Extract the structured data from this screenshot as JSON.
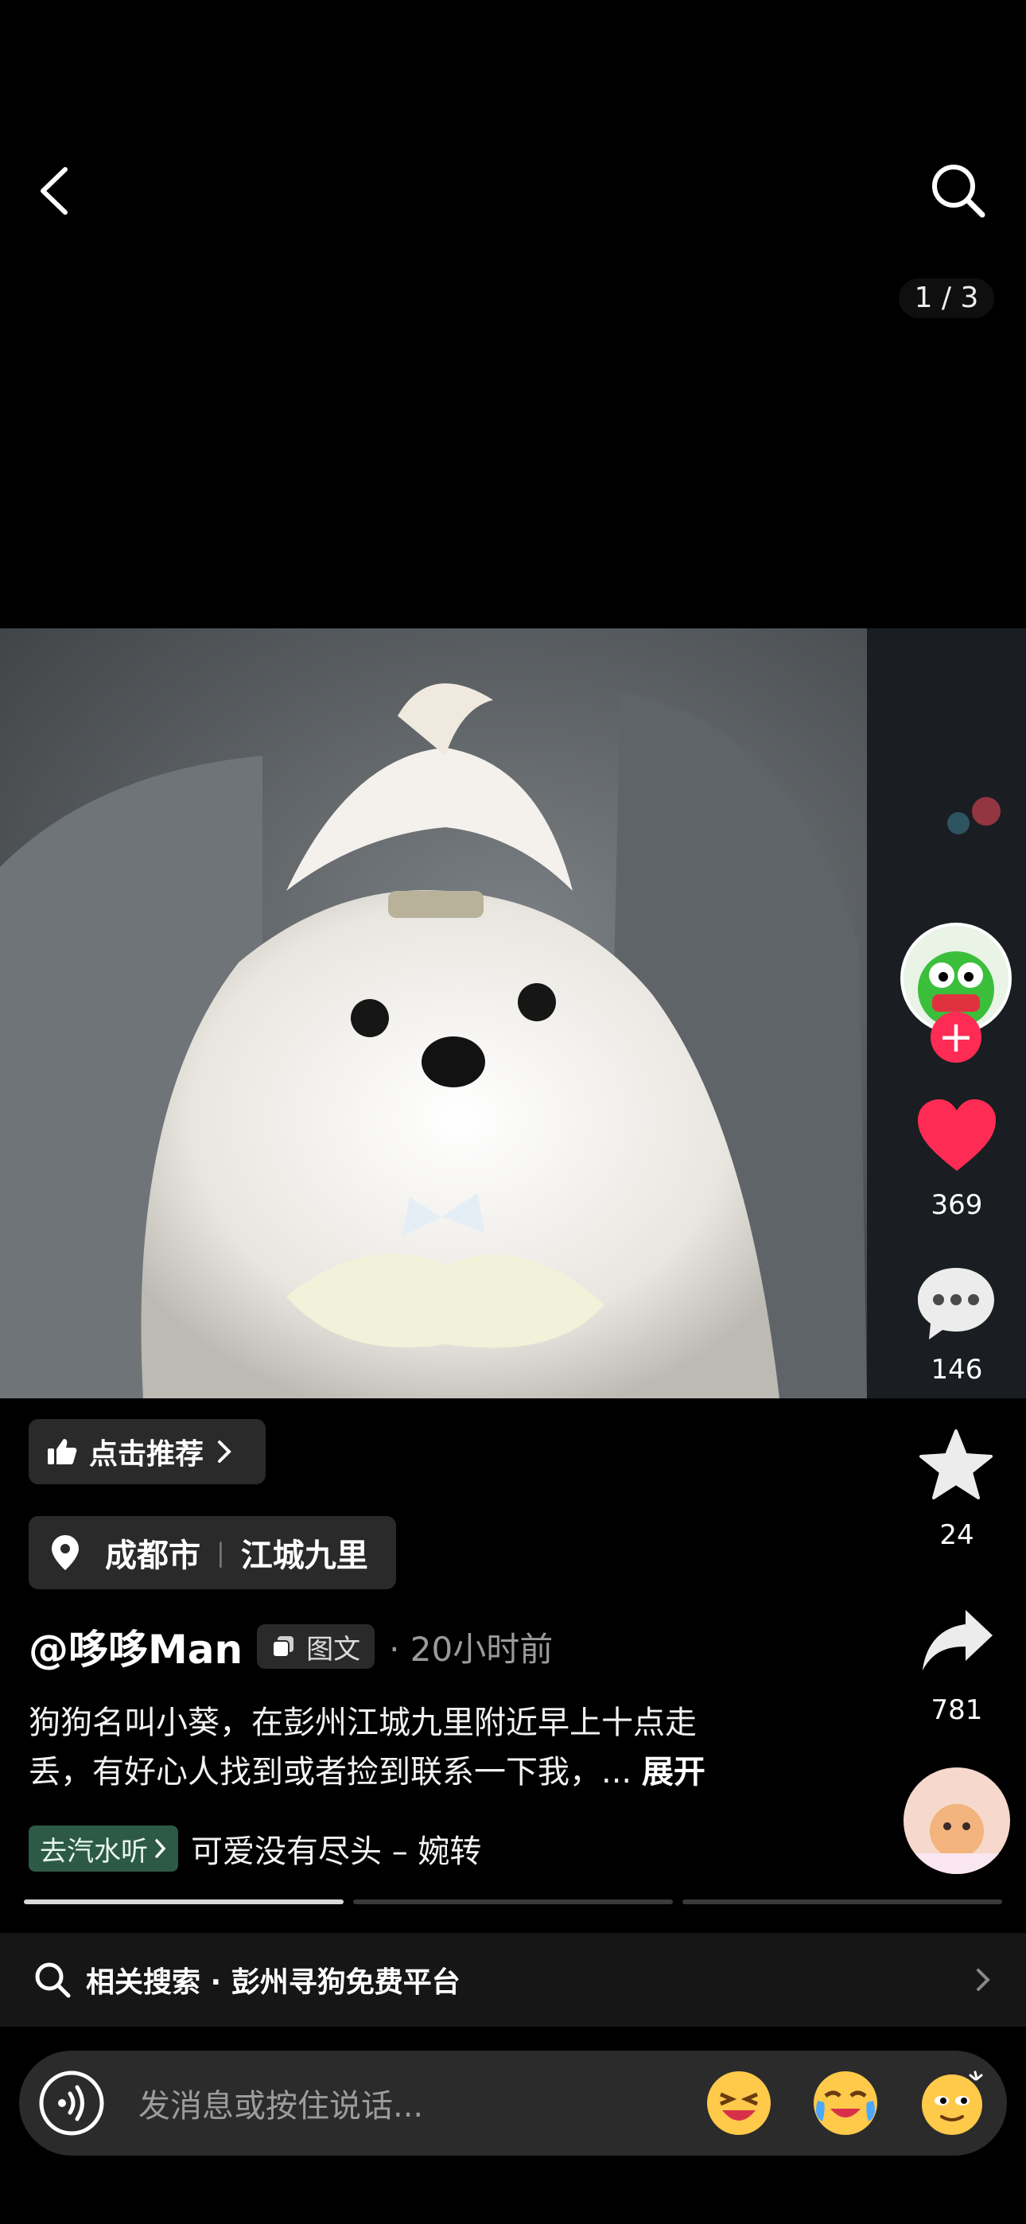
{
  "top": {
    "page_indicator": "1 / 3"
  },
  "rail": {
    "likes": "369",
    "comments": "146",
    "favorites": "24",
    "shares": "781"
  },
  "recommend": {
    "label": "点击推荐"
  },
  "location": {
    "city": "成都市",
    "place": "江城九里"
  },
  "post": {
    "author": "@哆哆Man",
    "type_badge": "图文",
    "time": "· 20小时前",
    "description_line1": "狗狗名叫小葵，在彭州江城九里附近早上十点走",
    "description_line2": "丢，有好心人找到或者捡到联系一下我，...",
    "expand_label": "展开"
  },
  "music": {
    "tag": "去汽水听",
    "title": "可爱没有尽头 – 婉转"
  },
  "related": {
    "label": "相关搜索 · 彭州寻狗免费平台"
  },
  "composer": {
    "placeholder": "发消息或按住说话..."
  },
  "colors": {
    "like": "#fe2c55",
    "follow": "#fe2c55",
    "music_tag": "#2d5a46"
  }
}
